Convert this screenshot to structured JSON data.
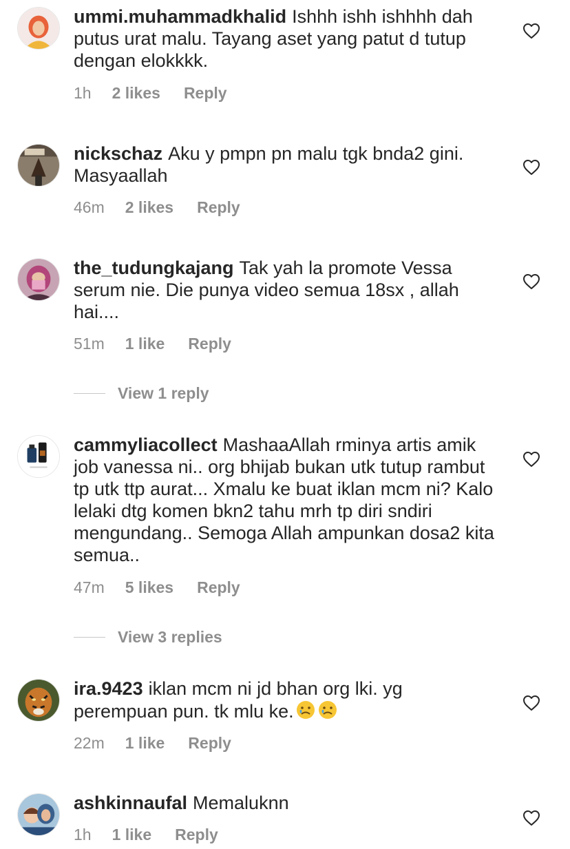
{
  "comments": [
    {
      "username": "ummi.muhammadkhalid",
      "text": "Ishhh ishh ishhhh dah putus urat malu. Tayang aset yang patut d tutup dengan elokkkk.",
      "time": "1h",
      "likes": "2 likes",
      "reply_label": "Reply"
    },
    {
      "username": "nickschaz",
      "text": "Aku y pmpn pn malu tgk bnda2 gini. Masyaallah",
      "time": "46m",
      "likes": "2 likes",
      "reply_label": "Reply"
    },
    {
      "username": "the_tudungkajang",
      "text": "Tak yah la promote Vessa serum nie. Die punya video semua 18sx , allah hai....",
      "time": "51m",
      "likes": "1 like",
      "reply_label": "Reply",
      "view_replies": "View 1 reply"
    },
    {
      "username": "cammyliacollect",
      "text": "MashaaAllah rminya artis amik job vanessa ni.. org bhijab bukan utk tutup rambut tp utk ttp aurat... Xmalu ke buat iklan mcm ni? Kalo lelaki dtg komen bkn2 tahu mrh tp diri sndiri mengundang.. Semoga Allah ampunkan dosa2 kita semua..",
      "time": "47m",
      "likes": "5 likes",
      "reply_label": "Reply",
      "view_replies": "View 3 replies"
    },
    {
      "username": "ira.9423",
      "text": "iklan mcm ni jd bhan org lki. yg perempuan pun. tk mlu ke.",
      "emoji": [
        "crying-face",
        "crying-face"
      ],
      "time": "22m",
      "likes": "1 like",
      "reply_label": "Reply"
    },
    {
      "username": "ashkinnaufal",
      "text": "Memaluknn",
      "time": "1h",
      "likes": "1 like",
      "reply_label": "Reply"
    }
  ],
  "colors": {
    "text": "#262626",
    "secondary": "#8e8e8e",
    "divider": "#c7c7c7",
    "background": "#ffffff"
  },
  "icons": {
    "like": "heart-outline-icon",
    "emoji": "crying-face-emoji"
  }
}
